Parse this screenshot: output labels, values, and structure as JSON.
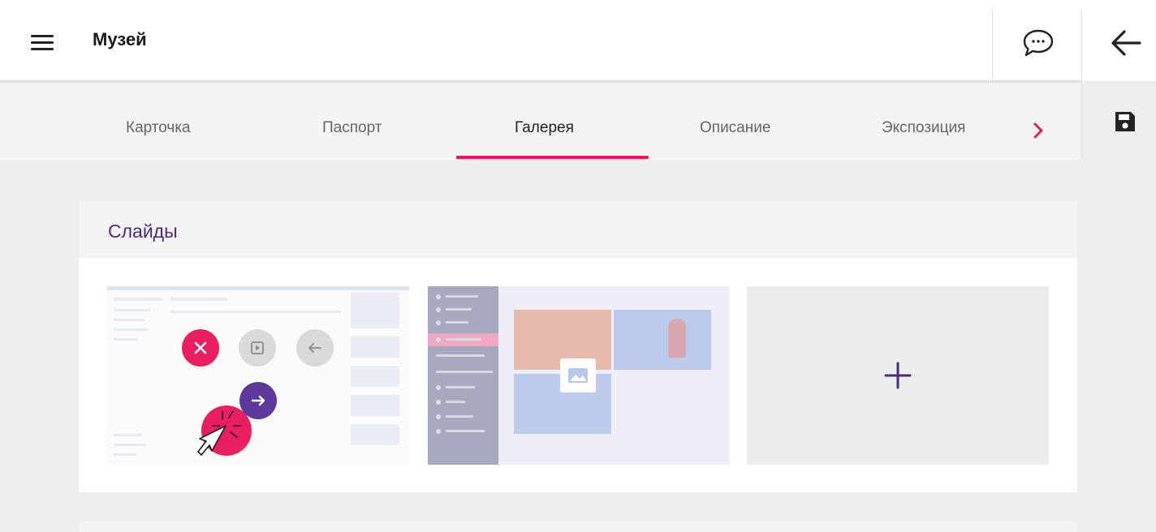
{
  "header": {
    "title": "Музей",
    "menu_icon": "hamburger-menu-icon",
    "chat_icon": "chat-bubble-icon",
    "back_icon": "arrow-left-icon",
    "save_icon": "floppy-disk-icon"
  },
  "tabs": [
    {
      "label": "Карточка",
      "active": false
    },
    {
      "label": "Паспорт",
      "active": false
    },
    {
      "label": "Галерея",
      "active": true
    },
    {
      "label": "Описание",
      "active": false
    },
    {
      "label": "Экспозиция",
      "active": false
    }
  ],
  "tabs_next_icon": "chevron-right-icon",
  "slides_section": {
    "title": "Слайды",
    "slides": [
      {
        "controls": [
          "delete-icon",
          "play-icon",
          "arrow-left-icon",
          "arrow-right-icon"
        ]
      },
      {
        "placeholder_icon": "image-icon"
      }
    ],
    "add_icon": "plus-icon"
  },
  "colors": {
    "accent": "#e9175e",
    "primary": "#4a2b7a",
    "move_button": "#5b3a9c",
    "background": "#eeeeee"
  }
}
